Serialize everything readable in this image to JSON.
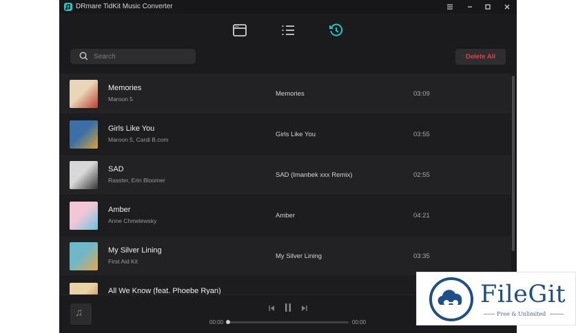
{
  "window": {
    "title": "DRmare TidKit Music Converter",
    "controls": [
      "menu-icon",
      "minimize-icon",
      "maximize-icon",
      "close-icon"
    ]
  },
  "toolbar": {
    "tabs": [
      {
        "icon": "browser-window-icon",
        "active": false
      },
      {
        "icon": "list-icon",
        "active": false
      },
      {
        "icon": "history-icon",
        "active": true
      }
    ],
    "accent": "#1ec8c8"
  },
  "search": {
    "placeholder": "Search",
    "value": ""
  },
  "actions": {
    "delete_all": "Delete All",
    "delete_color": "#e23f4f"
  },
  "tracks": [
    {
      "title": "Memories",
      "artist": "Maroon 5",
      "album": "Memories",
      "duration": "03:09",
      "cover_colors": [
        "#e9d6b8",
        "#b8402f"
      ]
    },
    {
      "title": "Girls Like You",
      "artist": "Maroon 5, Cardi B.com",
      "album": "Girls Like You",
      "duration": "03:55",
      "cover_colors": [
        "#3a6fa8",
        "#d9a23a"
      ]
    },
    {
      "title": "SAD",
      "artist": "Rasster, Erin Bloomer",
      "album": "SAD (Imanbek xxx Remix)",
      "duration": "02:55",
      "cover_colors": [
        "#d8d8d8",
        "#333333"
      ]
    },
    {
      "title": "Amber",
      "artist": "Anne Chmelewsky",
      "album": "Amber",
      "duration": "04:21",
      "cover_colors": [
        "#f2c6d6",
        "#6ac4e0"
      ]
    },
    {
      "title": "My Silver Lining",
      "artist": "First Aid Kit",
      "album": "My Silver Lining",
      "duration": "03:35",
      "cover_colors": [
        "#6fb8c8",
        "#e6a64a"
      ]
    },
    {
      "title": "All We Know (feat. Phoebe Ryan)",
      "artist": "",
      "album": "",
      "duration": "",
      "cover_colors": [
        "#e8d3a6",
        "#b86a3a"
      ]
    }
  ],
  "player": {
    "thumb_icon": "music-note-icon",
    "elapsed": "00:00",
    "total": "00:00",
    "progress": 0
  },
  "watermark": {
    "brand": "FileGit",
    "tagline": "Free & Unlimited",
    "colors": {
      "primary": "#1e4f86"
    }
  }
}
